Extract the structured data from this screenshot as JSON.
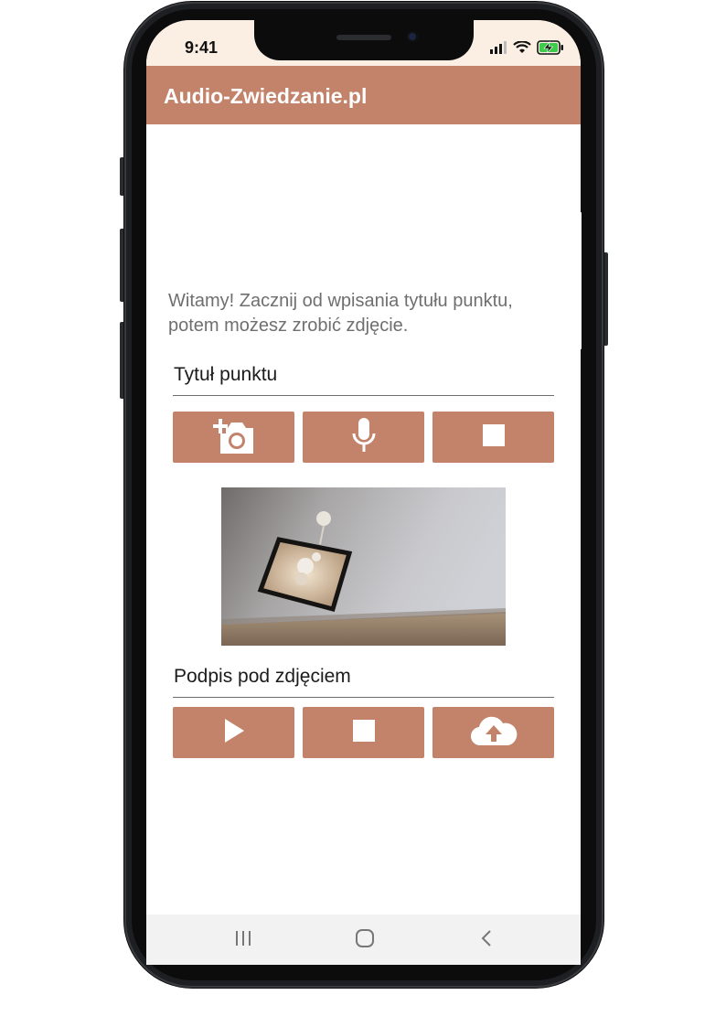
{
  "status_bar": {
    "time": "9:41"
  },
  "header": {
    "title": "Audio-Zwiedzanie.pl"
  },
  "welcome_text": "Witamy! Zacznij od wpisania tytułu punktu, potem możesz zrobić zdjęcie.",
  "title_field": {
    "value": "Tytuł punktu"
  },
  "caption_field": {
    "value": "Podpis pod zdjęciem"
  },
  "record_controls": {
    "icons": [
      "add-photo-icon",
      "microphone-icon",
      "stop-icon"
    ]
  },
  "playback_controls": {
    "icons": [
      "play-icon",
      "stop-icon",
      "cloud-upload-icon"
    ]
  },
  "colors": {
    "accent": "#c2836a",
    "status_bar_bg": "#fbeee3",
    "nav_bar_bg": "#f2f2f2",
    "welcome_text": "#6f6f6f"
  },
  "nav_bar": {
    "icons": [
      "recent-apps-icon",
      "home-icon",
      "back-icon"
    ]
  }
}
